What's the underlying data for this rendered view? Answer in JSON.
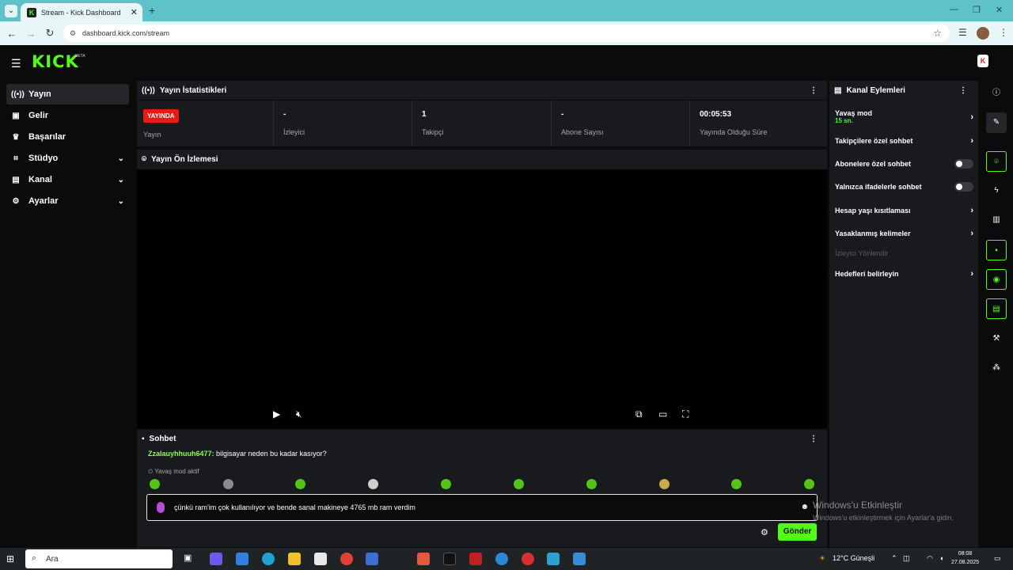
{
  "browser": {
    "tab_title": "Stream - Kick Dashboard",
    "url": "dashboard.kick.com/stream"
  },
  "header": {
    "logo": "KICK",
    "beta": "BETA"
  },
  "sidebar": {
    "items": [
      {
        "label": "Yayın",
        "icon": "broadcast-icon"
      },
      {
        "label": "Gelir",
        "icon": "wallet-icon"
      },
      {
        "label": "Başarılar",
        "icon": "trophy-icon"
      },
      {
        "label": "Stüdyo",
        "icon": "studio-icon"
      },
      {
        "label": "Kanal",
        "icon": "channel-icon"
      },
      {
        "label": "Ayarlar",
        "icon": "gear-icon"
      }
    ]
  },
  "stats": {
    "title": "Yayın İstatistikleri",
    "live_badge": "YAYINDA",
    "cards": [
      {
        "value": "",
        "label": "Yayın"
      },
      {
        "value": "-",
        "label": "İzleyici"
      },
      {
        "value": "1",
        "label": "Takipçi"
      },
      {
        "value": "-",
        "label": "Abone Sayısı"
      },
      {
        "value": "00:05:53",
        "label": "Yayında Olduğu Süre"
      }
    ]
  },
  "preview": {
    "title": "Yayın Ön İzlemesi"
  },
  "chat": {
    "title": "Sohbet",
    "message_user": "Zzalauyhhuuh6477:",
    "message_text": " bilgisayar neden bu kadar kasıyor?",
    "slow_mode": "Yavaş mod aktif",
    "input_text": "çünkü ram'im çok kullanılıyor ve bende sanal makineye 4765 mb ram verdim",
    "send_label": "Gönder"
  },
  "actions": {
    "title": "Kanal Eylemleri",
    "slow_mode": "Yavaş mod",
    "slow_mode_value": "15 sn.",
    "followers_only": "Takipçilere özel sohbet",
    "subs_only": "Abonelere özel sohbet",
    "emote_only": "Yalnızca ifadelerle sohbet",
    "age_restriction": "Hesap yaşı kısıtlaması",
    "banned_words": "Yasaklanmış kelimeler",
    "raid": "İzleyici Yönlendir",
    "goals": "Hedefleri belirleyin"
  },
  "watermark": {
    "line1": "Windows'u Etkinleştir",
    "line2": "Windows'u etkinleştirmek için Ayarlar'a gidin."
  },
  "taskbar": {
    "search_placeholder": "Ara",
    "weather": "12°C  Güneşli",
    "time": "08:08",
    "date": "27.08.2025"
  },
  "colors": {
    "accent": "#53fc18",
    "live": "#e91916",
    "panel": "#191a1d",
    "background": "#0b0b0c"
  }
}
